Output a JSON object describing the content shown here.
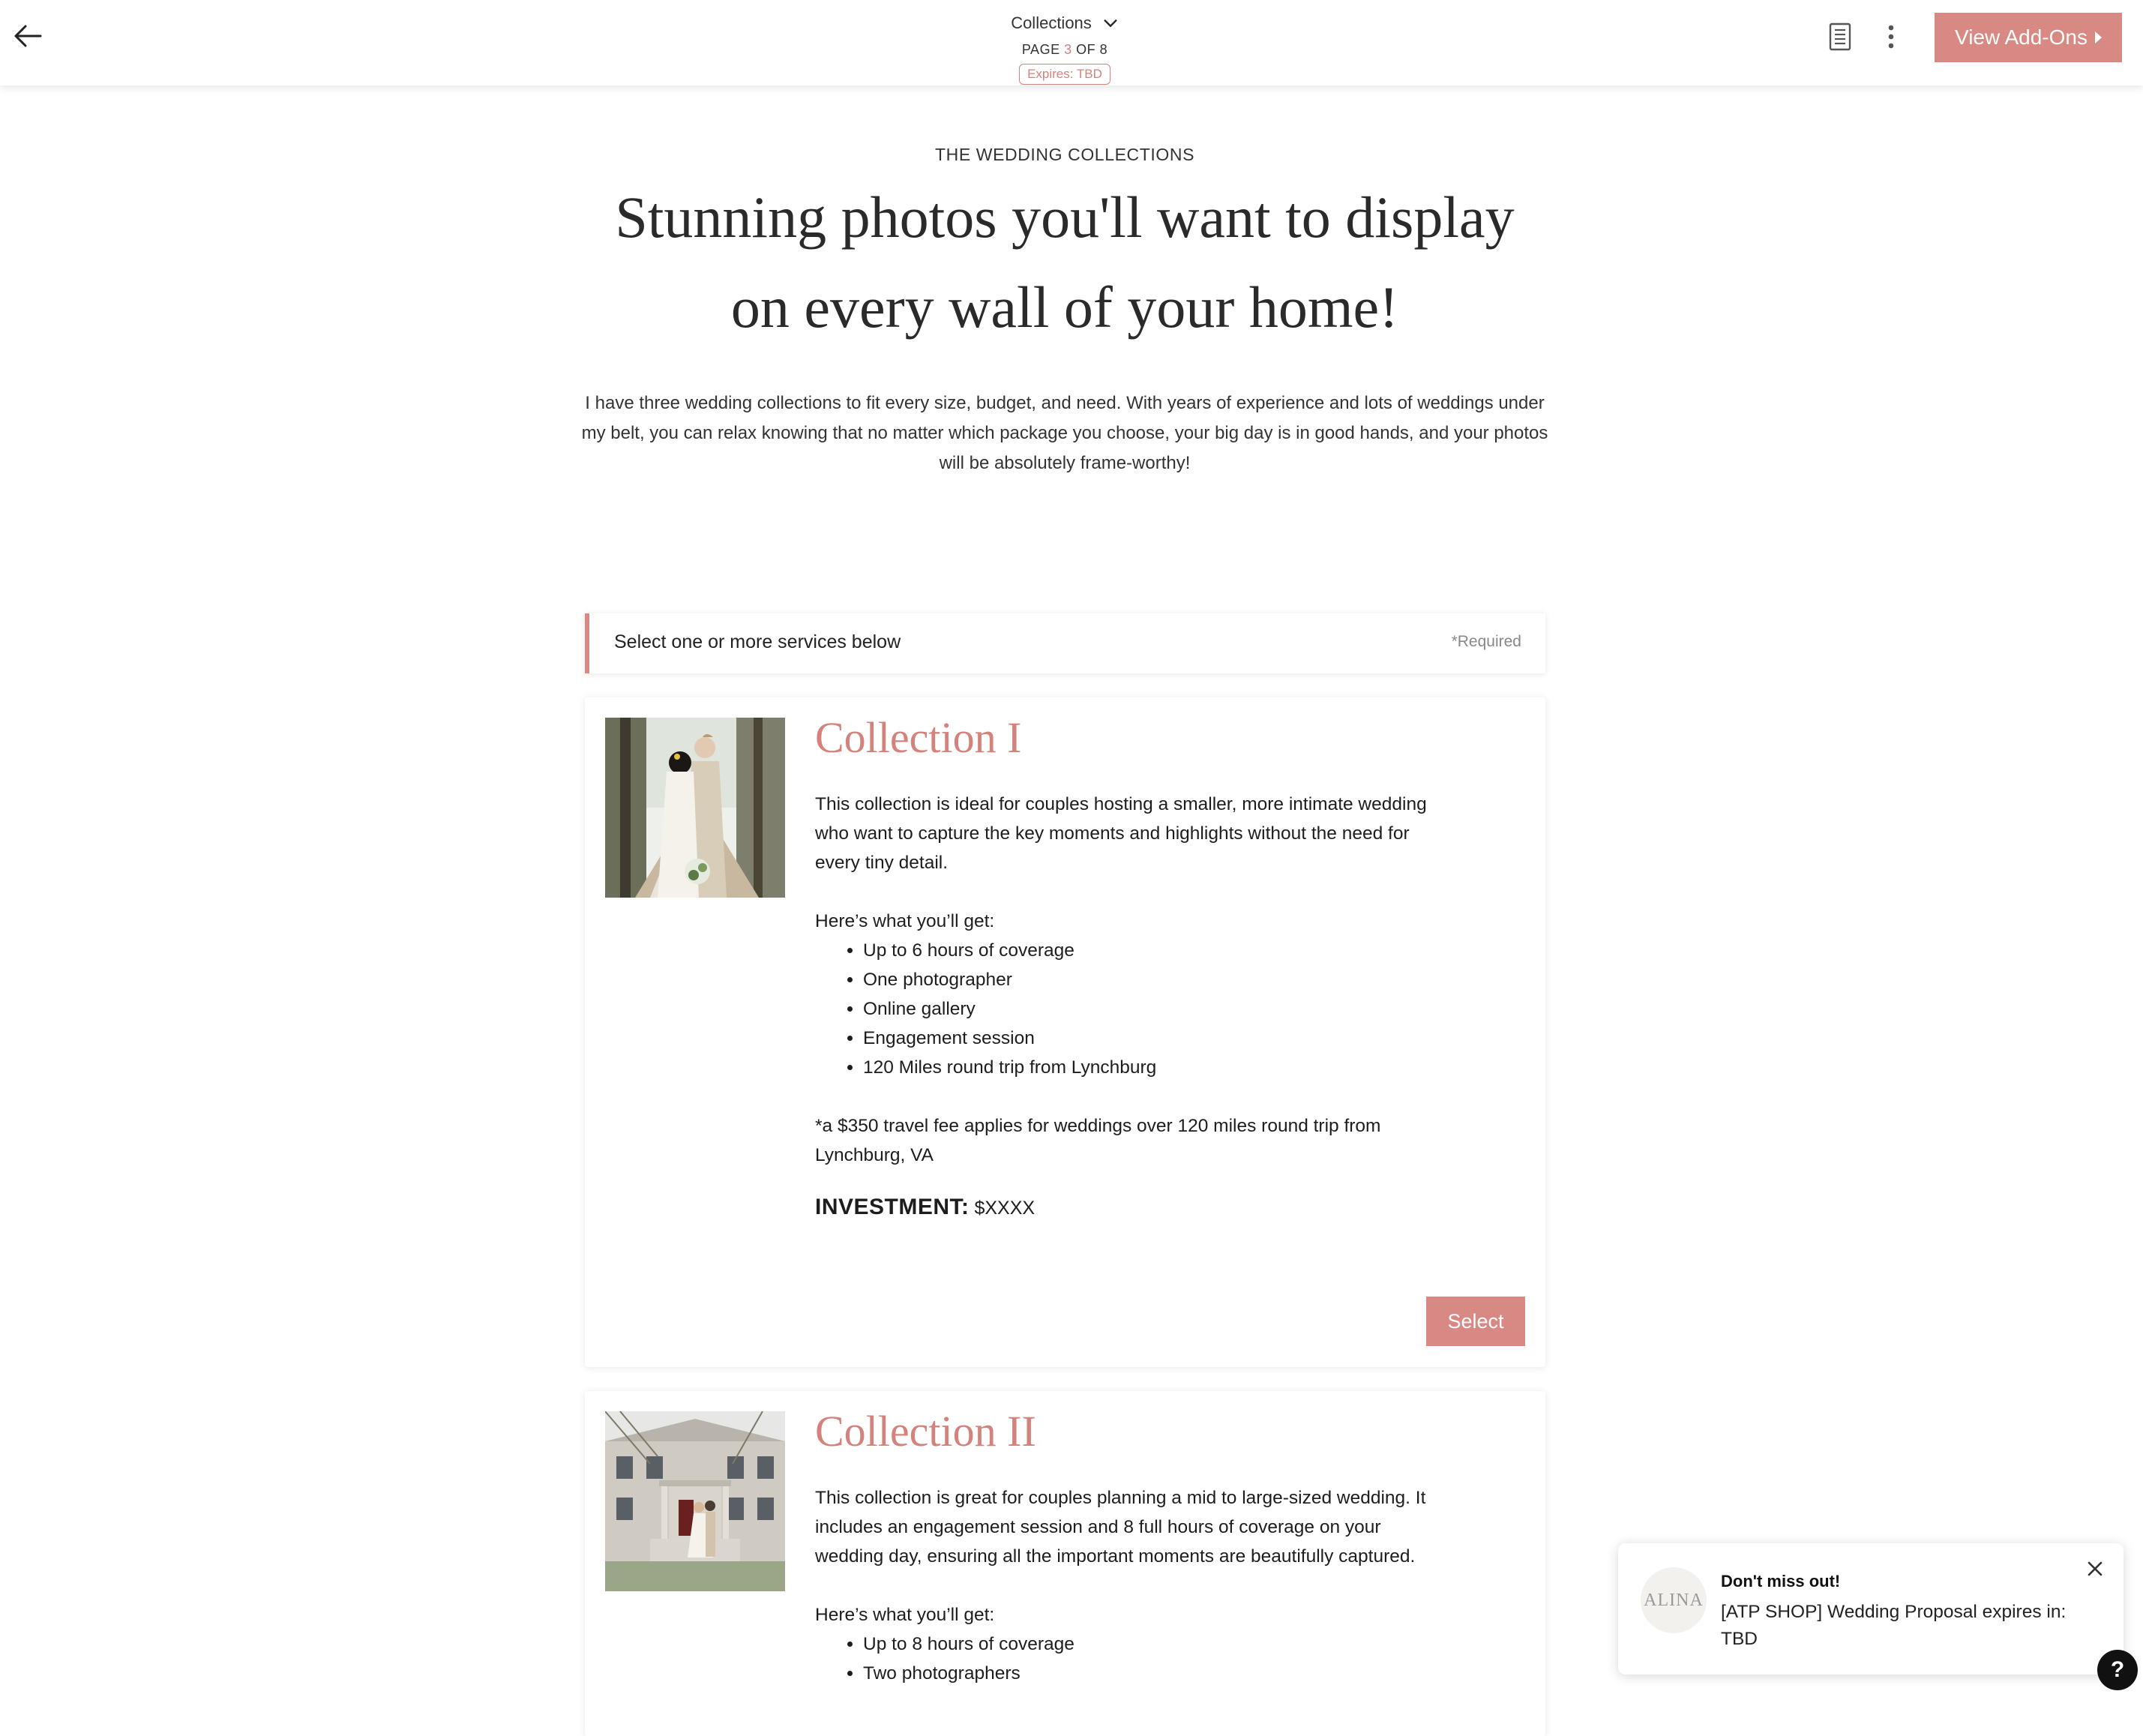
{
  "header": {
    "section_title": "Collections",
    "page_prefix": "PAGE ",
    "page_current": "3",
    "page_suffix": " OF 8",
    "expires": "Expires: TBD",
    "addons_label": "View Add-Ons"
  },
  "intro": {
    "eyebrow": "THE WEDDING COLLECTIONS",
    "headline_line1": "Stunning photos you'll want to display",
    "headline_line2": "on every wall of your home!",
    "body": "I have three wedding collections to fit every size, budget, and need. With years of experience and lots of weddings under my belt, you can relax knowing that no matter which package you choose, your big day is in good hands, and your photos will be absolutely frame-worthy!"
  },
  "selector": {
    "label": "Select one or more services below",
    "required": "*Required"
  },
  "collections": [
    {
      "title": "Collection I",
      "description": "This collection is ideal for couples hosting a smaller, more intimate wedding who want to capture the key moments and highlights without the need for every tiny detail.",
      "list_intro": "Here’s what you’ll get:",
      "items": [
        "Up to 6 hours of coverage",
        "One photographer",
        "Online gallery",
        "Engagement session",
        "120 Miles round trip from Lynchburg"
      ],
      "note": "*a $350 travel fee applies for weddings over 120 miles round trip from Lynchburg, VA",
      "investment_label": "INVESTMENT:",
      "investment_value": " $XXXX",
      "select_label": "Select"
    },
    {
      "title": "Collection II",
      "description": "This collection is great for couples planning a mid to large-sized wedding. It includes an engagement session and 8 full hours of coverage on your wedding day, ensuring all the important moments are beautifully captured.",
      "list_intro": "Here’s what you’ll get:",
      "items": [
        "Up to 8 hours of coverage",
        "Two photographers"
      ]
    }
  ],
  "toast": {
    "logo_text": "ALINA",
    "title": "Don't miss out!",
    "message": "[ATP SHOP] Wedding Proposal expires in: TBD"
  },
  "help": {
    "label": "?"
  },
  "colors": {
    "accent": "#d98983",
    "accent_text": "#d4827b"
  }
}
